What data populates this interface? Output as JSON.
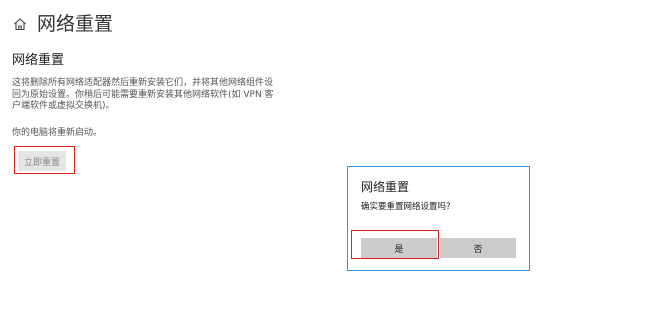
{
  "header": {
    "home_icon": "home-icon",
    "title": "网络重置"
  },
  "section": {
    "heading": "网络重置",
    "description": "这将删除所有网络适配器然后重新安装它们，并将其他网络组件设回为原始设置。你稍后可能需要重新安装其他网络软件(如 VPN 客户端软件或虚拟交换机)。",
    "restart_note": "你的电脑将重新启动。",
    "reset_button_label": "立即重置"
  },
  "dialog": {
    "title": "网络重置",
    "message": "确实要重置网络设置吗?",
    "yes_label": "是",
    "no_label": "否",
    "border_color": "#3b8fe0"
  },
  "annotations": {
    "highlight_color": "#e02020"
  }
}
